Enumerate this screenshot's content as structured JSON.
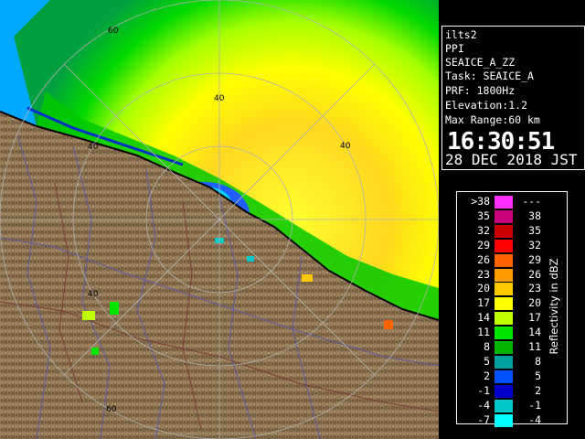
{
  "info": {
    "site": "ilts2",
    "scan_type": "PPI",
    "product": "SEAICE_A_ZZ",
    "task": "Task: SEAICE_A",
    "prf": "PRF: 1800Hz",
    "elevation": "Elevation:1.2",
    "max_range": "Max Range:60 km",
    "time": "16:30:51",
    "date": "28 DEC 2018 JST"
  },
  "legend": {
    "title": "Reflectivity in dBZ",
    "rows": [
      {
        "low": ">38",
        "high": "---",
        "color": "#ff30ff"
      },
      {
        "low": "35",
        "high": "38",
        "color": "#c8007c"
      },
      {
        "low": "32",
        "high": "35",
        "color": "#cc0000"
      },
      {
        "low": "29",
        "high": "32",
        "color": "#ff0000"
      },
      {
        "low": "26",
        "high": "29",
        "color": "#ff6400"
      },
      {
        "low": "23",
        "high": "26",
        "color": "#ff9b00"
      },
      {
        "low": "20",
        "high": "23",
        "color": "#ffc800"
      },
      {
        "low": "17",
        "high": "20",
        "color": "#ffff00"
      },
      {
        "low": "14",
        "high": "17",
        "color": "#bfff00"
      },
      {
        "low": "11",
        "high": "14",
        "color": "#00e600"
      },
      {
        "low": "8",
        "high": "11",
        "color": "#00b400"
      },
      {
        "low": "5",
        "high": "8",
        "color": "#00a0a0"
      },
      {
        "low": "2",
        "high": "5",
        "color": "#0050ff"
      },
      {
        "low": "-1",
        "high": "2",
        "color": "#0000c8"
      },
      {
        "low": "-4",
        "high": "-1",
        "color": "#00c8c8"
      },
      {
        "low": "-7",
        "high": "-4",
        "color": "#00ffff"
      }
    ]
  },
  "map": {
    "range_ring_labels": [
      "60",
      "40",
      "40",
      "40",
      "40",
      "60"
    ],
    "colors": {
      "land": "#8c7250",
      "coast": "#000000",
      "rings": "#b0b0b0",
      "roads": "#5a5aa0",
      "rivers": "#7a3c3c"
    }
  }
}
